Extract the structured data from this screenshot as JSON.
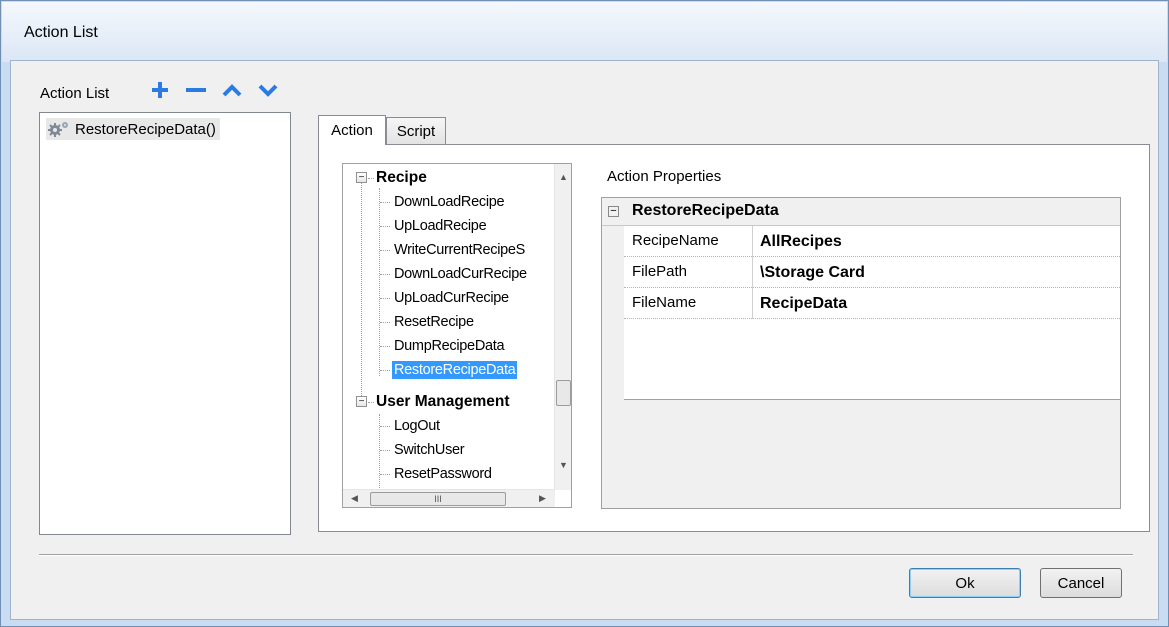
{
  "window": {
    "title": "Action List"
  },
  "action_list": {
    "label": "Action List",
    "toolbar": {
      "add_icon": "plus-icon",
      "remove_icon": "minus-icon",
      "up_icon": "chevron-up-icon",
      "down_icon": "chevron-down-icon",
      "icon_color": "#2a7be4"
    },
    "items": [
      {
        "label": "RestoreRecipeData()",
        "icon": "gear-icon"
      }
    ]
  },
  "tabs": [
    {
      "label": "Action",
      "active": true
    },
    {
      "label": "Script",
      "active": false
    }
  ],
  "tree": {
    "categories": [
      {
        "label": "Recipe",
        "expanded": true,
        "items": [
          "DownLoadRecipe",
          "UpLoadRecipe",
          "WriteCurrentRecipeS",
          "DownLoadCurRecipe",
          "UpLoadCurRecipe",
          "ResetRecipe",
          "DumpRecipeData",
          "RestoreRecipeData"
        ]
      },
      {
        "label": "User Management",
        "expanded": true,
        "items": [
          "LogOut",
          "SwitchUser",
          "ResetPassword"
        ]
      }
    ],
    "selected": "RestoreRecipeData",
    "hscroll_thumb_glyph": "III"
  },
  "properties": {
    "label": "Action Properties",
    "category": "RestoreRecipeData",
    "collapse_glyph": "−",
    "rows": [
      {
        "name": "RecipeName",
        "value": "AllRecipes"
      },
      {
        "name": "FilePath",
        "value": "\\Storage Card"
      },
      {
        "name": "FileName",
        "value": "RecipeData"
      }
    ]
  },
  "buttons": {
    "ok": "Ok",
    "cancel": "Cancel"
  }
}
